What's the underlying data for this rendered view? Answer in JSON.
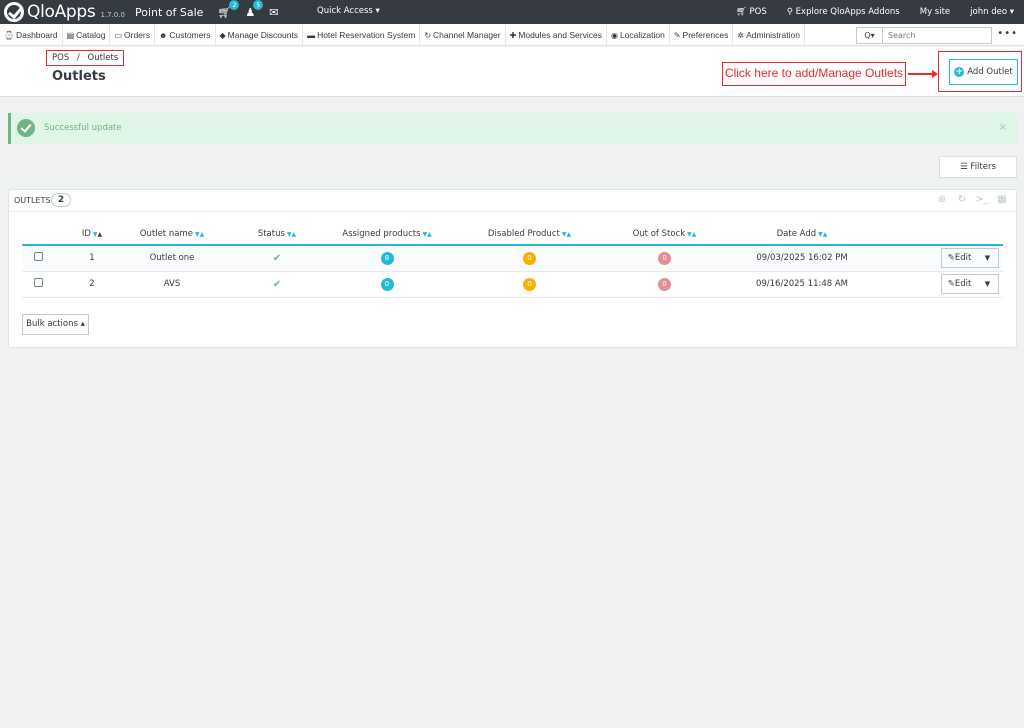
{
  "topbar": {
    "app_name": "QloApps",
    "version": "1.7.0.0",
    "module_title": "Point of Sale",
    "cart_badge": "2",
    "customer_badge": "5",
    "quick_access": "Quick Access ▾",
    "pos_link": "POS",
    "addons_link": "Explore QloApps Addons",
    "my_site": "My site",
    "user": "john deo ▾"
  },
  "nav": {
    "items": [
      {
        "icon": "⌚",
        "label": "Dashboard"
      },
      {
        "icon": "▤",
        "label": "Catalog"
      },
      {
        "icon": "▭",
        "label": "Orders"
      },
      {
        "icon": "☻",
        "label": "Customers"
      },
      {
        "icon": "◆",
        "label": "Manage Discounts"
      },
      {
        "icon": "▬",
        "label": "Hotel Reservation System"
      },
      {
        "icon": "↻",
        "label": "Channel Manager"
      },
      {
        "icon": "✚",
        "label": "Modules and Services"
      },
      {
        "icon": "◉",
        "label": "Localization"
      },
      {
        "icon": "✎",
        "label": "Preferences"
      },
      {
        "icon": "✲",
        "label": "Administration"
      }
    ],
    "search_button": "Q▾",
    "search_placeholder": "Search",
    "more": "•••"
  },
  "header": {
    "breadcrumb_parent": "POS",
    "breadcrumb_separator": "/",
    "breadcrumb_current": "Outlets",
    "title": "Outlets",
    "callout": "Click here to add/Manage Outlets",
    "add_button": "Add Outlet"
  },
  "alert": {
    "message": "Successful update",
    "close": "×"
  },
  "filters_label": "Filters",
  "panel": {
    "title": "OUTLETS",
    "count": "2",
    "columns": [
      "ID",
      "Outlet name",
      "Status",
      "Assigned products",
      "Disabled Product",
      "Out of Stock",
      "Date Add"
    ],
    "rows": [
      {
        "id": "1",
        "name": "Outlet one",
        "status": "✔",
        "assigned": "8",
        "disabled": "0",
        "out_of_stock": "0",
        "date": "09/03/2025 16:02 PM",
        "action": "Edit"
      },
      {
        "id": "2",
        "name": "AVS",
        "status": "✔",
        "assigned": "0",
        "disabled": "0",
        "out_of_stock": "0",
        "date": "09/16/2025 11:48 AM",
        "action": "Edit"
      }
    ],
    "bulk_actions": "Bulk actions ▴"
  },
  "colors": {
    "topbar": "#363a41",
    "accent": "#25b9d7",
    "success": "#70b580",
    "warning": "#fab000",
    "danger_soft": "#e08f95",
    "annotation": "#e52b2b"
  }
}
